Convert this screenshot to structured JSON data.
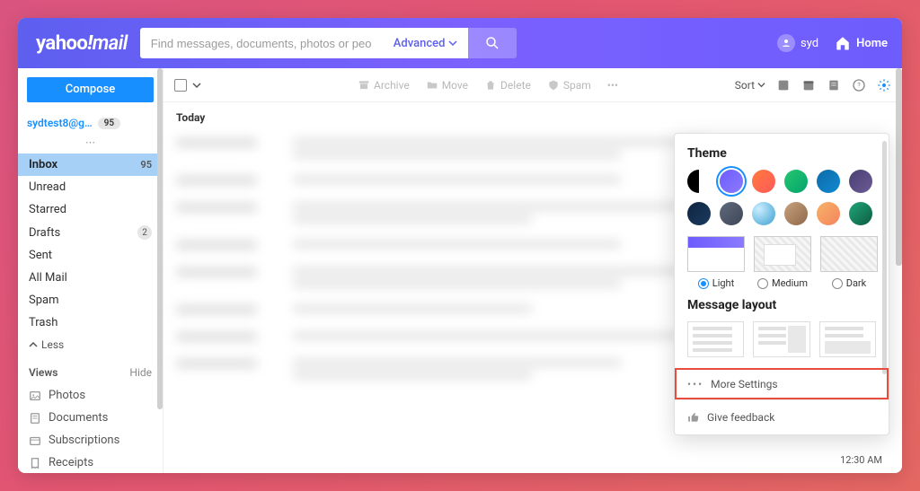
{
  "brand": {
    "part1": "yahoo",
    "part2": "!",
    "part3": "mail"
  },
  "search": {
    "placeholder": "Find messages, documents, photos or people",
    "advanced_label": "Advanced"
  },
  "header": {
    "username": "syd",
    "home_label": "Home"
  },
  "compose_label": "Compose",
  "account": {
    "email": "sydtest8@g…",
    "unread_badge": "95"
  },
  "folders": [
    {
      "label": "Inbox",
      "count": "95",
      "active": true
    },
    {
      "label": "Unread"
    },
    {
      "label": "Starred"
    },
    {
      "label": "Drafts",
      "badge": "2"
    },
    {
      "label": "Sent"
    },
    {
      "label": "All Mail"
    },
    {
      "label": "Spam"
    },
    {
      "label": "Trash"
    }
  ],
  "less_label": "Less",
  "views": {
    "header": "Views",
    "hide": "Hide",
    "items": [
      "Photos",
      "Documents",
      "Subscriptions",
      "Receipts"
    ]
  },
  "toolbar": {
    "archive": "Archive",
    "move": "Move",
    "delete": "Delete",
    "spam": "Spam",
    "sort": "Sort"
  },
  "date_group": "Today",
  "timestamp": "12:30 AM",
  "settings": {
    "theme_title": "Theme",
    "modes": {
      "light": "Light",
      "medium": "Medium",
      "dark": "Dark"
    },
    "layout_title": "Message layout",
    "more": "More Settings",
    "feedback": "Give feedback",
    "theme_colors": [
      "linear-gradient(90deg,#000 50%,#fff 50%)",
      "linear-gradient(135deg,#6d5dfc,#8b7aff)",
      "linear-gradient(135deg,#ff7a3d,#ff5a5a)",
      "linear-gradient(135deg,#28c76f,#00a36c)",
      "linear-gradient(135deg,#0e6ba8,#1089d1)",
      "linear-gradient(135deg,#4b3f72,#6b5b95)",
      "linear-gradient(135deg,#102542,#1a3a5f)",
      "linear-gradient(135deg,#5f6a7d,#3e4756)",
      "radial-gradient(circle at 30% 30%,#cceeff,#3aa0d1)",
      "linear-gradient(135deg,#c9a27e,#8d6748)",
      "linear-gradient(135deg,#f7b267,#f4845f)",
      "linear-gradient(135deg,#1fa67a,#0d5c3f)"
    ],
    "selected_theme_index": 1,
    "selected_mode": "light"
  }
}
